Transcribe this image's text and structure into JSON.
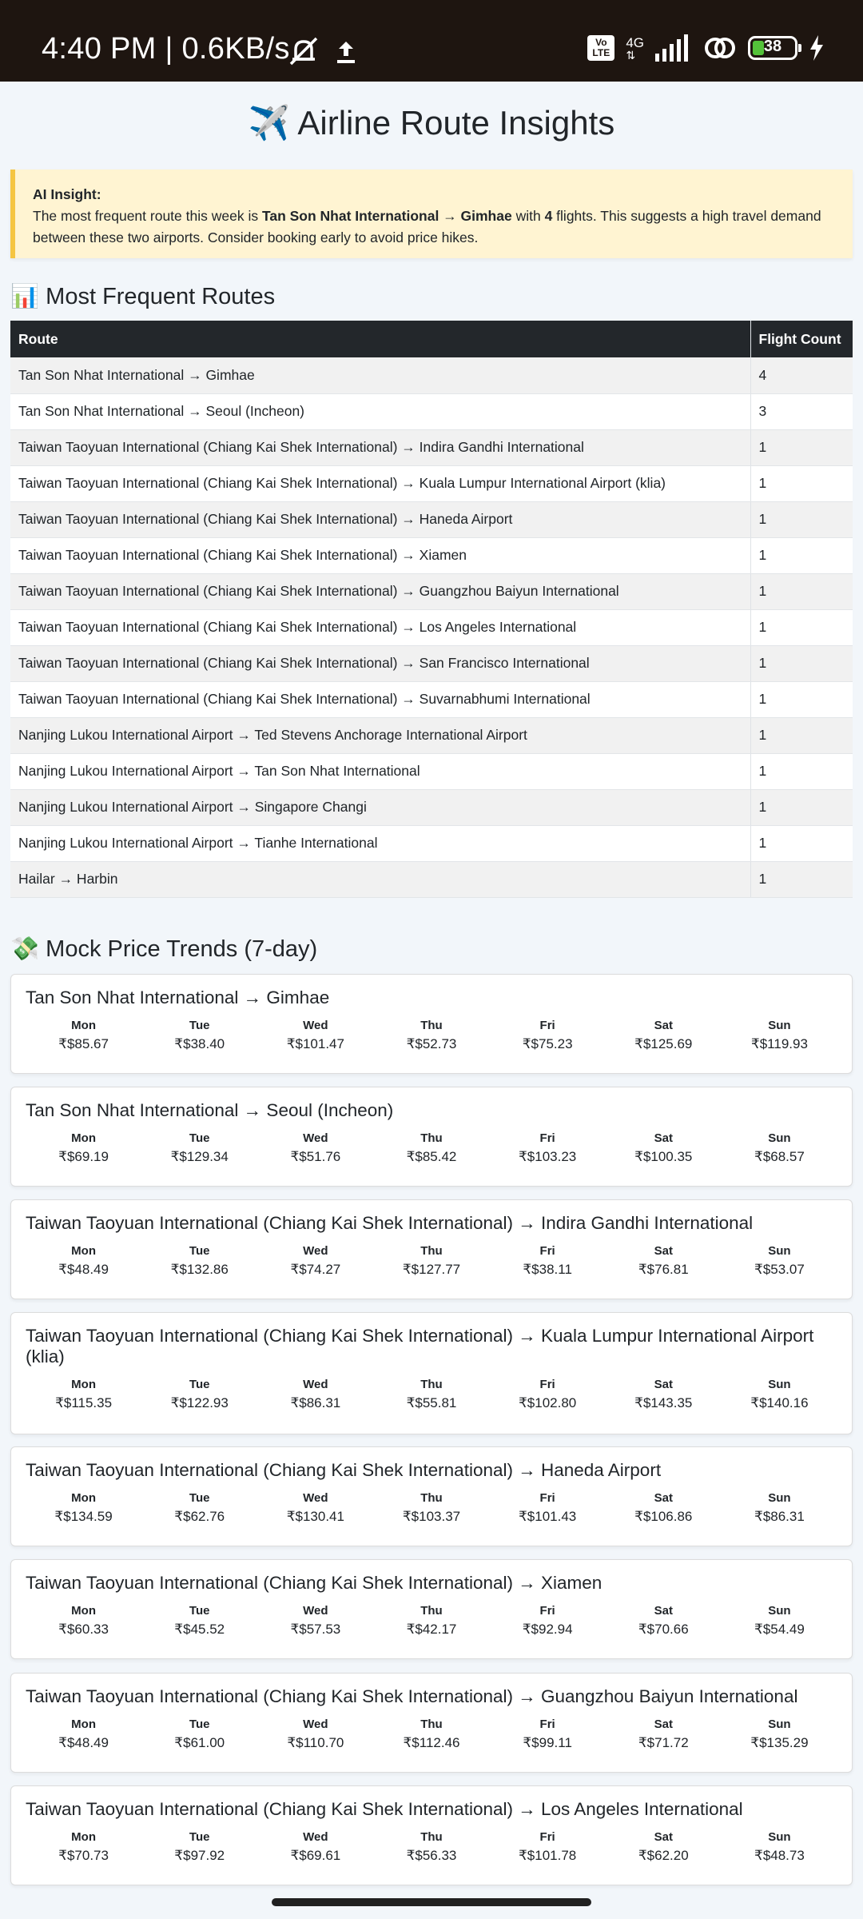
{
  "status_bar": {
    "time": "4:40 PM | 0.6KB/s",
    "network": "4G",
    "battery": "38"
  },
  "title": "✈️ Airline Route Insights",
  "insight": {
    "label": "AI Insight:",
    "pre": "The most frequent route this week is ",
    "route": "Tan Son Nhat International → Gimhae",
    "mid": " with ",
    "count": "4",
    "post": " flights. This suggests a high travel demand between these two airports. Consider booking early to avoid price hikes."
  },
  "frequent": {
    "heading": "📊 Most Frequent Routes",
    "columns": [
      "Route",
      "Flight Count"
    ],
    "rows": [
      [
        "Tan Son Nhat International → Gimhae",
        "4"
      ],
      [
        "Tan Son Nhat International → Seoul (Incheon)",
        "3"
      ],
      [
        "Taiwan Taoyuan International (Chiang Kai Shek International) → Indira Gandhi International",
        "1"
      ],
      [
        "Taiwan Taoyuan International (Chiang Kai Shek International) → Kuala Lumpur International Airport (klia)",
        "1"
      ],
      [
        "Taiwan Taoyuan International (Chiang Kai Shek International) → Haneda Airport",
        "1"
      ],
      [
        "Taiwan Taoyuan International (Chiang Kai Shek International) → Xiamen",
        "1"
      ],
      [
        "Taiwan Taoyuan International (Chiang Kai Shek International) → Guangzhou Baiyun International",
        "1"
      ],
      [
        "Taiwan Taoyuan International (Chiang Kai Shek International) → Los Angeles International",
        "1"
      ],
      [
        "Taiwan Taoyuan International (Chiang Kai Shek International) → San Francisco International",
        "1"
      ],
      [
        "Taiwan Taoyuan International (Chiang Kai Shek International) → Suvarnabhumi International",
        "1"
      ],
      [
        "Nanjing Lukou International Airport → Ted Stevens Anchorage International Airport",
        "1"
      ],
      [
        "Nanjing Lukou International Airport → Tan Son Nhat International",
        "1"
      ],
      [
        "Nanjing Lukou International Airport → Singapore Changi",
        "1"
      ],
      [
        "Nanjing Lukou International Airport → Tianhe International",
        "1"
      ],
      [
        "Hailar → Harbin",
        "1"
      ]
    ]
  },
  "trends": {
    "heading": "💸 Mock Price Trends (7-day)",
    "days": [
      "Mon",
      "Tue",
      "Wed",
      "Thu",
      "Fri",
      "Sat",
      "Sun"
    ],
    "cards": [
      {
        "route": "Tan Son Nhat International → Gimhae",
        "prices": [
          "₹$85.67",
          "₹$38.40",
          "₹$101.47",
          "₹$52.73",
          "₹$75.23",
          "₹$125.69",
          "₹$119.93"
        ]
      },
      {
        "route": "Tan Son Nhat International → Seoul (Incheon)",
        "prices": [
          "₹$69.19",
          "₹$129.34",
          "₹$51.76",
          "₹$85.42",
          "₹$103.23",
          "₹$100.35",
          "₹$68.57"
        ]
      },
      {
        "route": "Taiwan Taoyuan International (Chiang Kai Shek International) → Indira Gandhi International",
        "prices": [
          "₹$48.49",
          "₹$132.86",
          "₹$74.27",
          "₹$127.77",
          "₹$38.11",
          "₹$76.81",
          "₹$53.07"
        ]
      },
      {
        "route": "Taiwan Taoyuan International (Chiang Kai Shek International) → Kuala Lumpur International Airport (klia)",
        "prices": [
          "₹$115.35",
          "₹$122.93",
          "₹$86.31",
          "₹$55.81",
          "₹$102.80",
          "₹$143.35",
          "₹$140.16"
        ]
      },
      {
        "route": "Taiwan Taoyuan International (Chiang Kai Shek International) → Haneda Airport",
        "prices": [
          "₹$134.59",
          "₹$62.76",
          "₹$130.41",
          "₹$103.37",
          "₹$101.43",
          "₹$106.86",
          "₹$86.31"
        ]
      },
      {
        "route": "Taiwan Taoyuan International (Chiang Kai Shek International) → Xiamen",
        "prices": [
          "₹$60.33",
          "₹$45.52",
          "₹$57.53",
          "₹$42.17",
          "₹$92.94",
          "₹$70.66",
          "₹$54.49"
        ]
      },
      {
        "route": "Taiwan Taoyuan International (Chiang Kai Shek International) → Guangzhou Baiyun International",
        "prices": [
          "₹$48.49",
          "₹$61.00",
          "₹$110.70",
          "₹$112.46",
          "₹$99.11",
          "₹$71.72",
          "₹$135.29"
        ]
      },
      {
        "route": "Taiwan Taoyuan International (Chiang Kai Shek International) → Los Angeles International",
        "prices": [
          "₹$70.73",
          "₹$97.92",
          "₹$69.61",
          "₹$56.33",
          "₹$101.78",
          "₹$62.20",
          "₹$48.73"
        ]
      }
    ]
  }
}
